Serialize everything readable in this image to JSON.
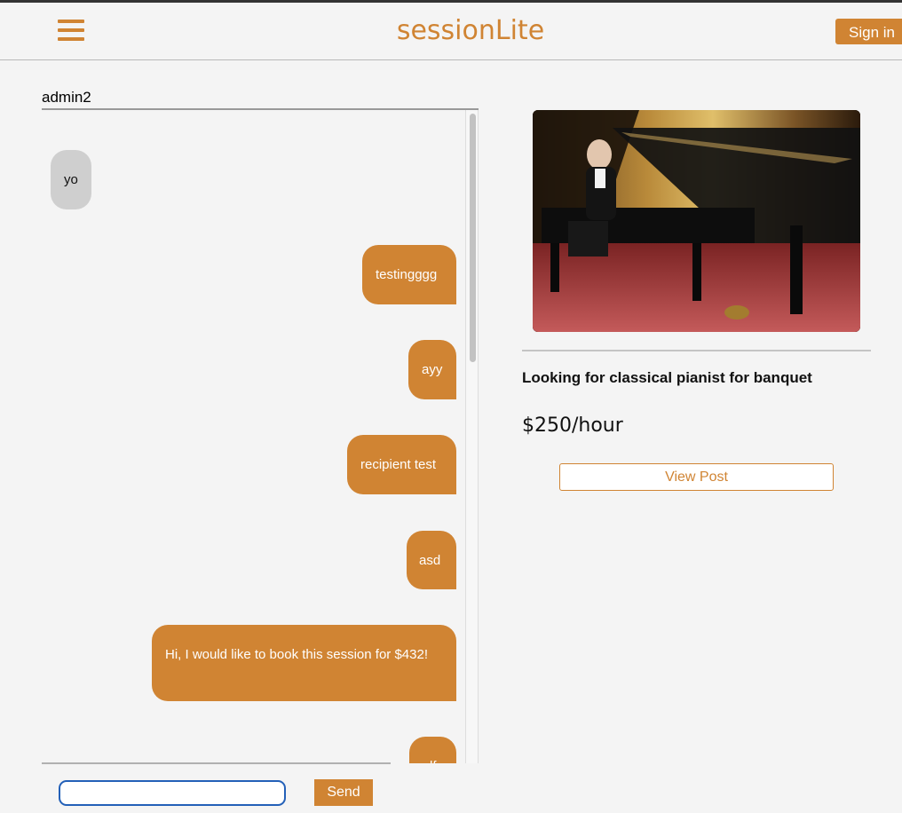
{
  "header": {
    "brand": "sessionLite",
    "signin_label": "Sign in",
    "menu_icon": "hamburger-menu-icon"
  },
  "chat": {
    "recipient": "admin2",
    "messages": [
      {
        "text": "yo",
        "direction": "in"
      },
      {
        "text": "testingggg",
        "direction": "out"
      },
      {
        "text": "ayy",
        "direction": "out"
      },
      {
        "text": "recipient test",
        "direction": "out"
      },
      {
        "text": "asd",
        "direction": "out"
      },
      {
        "text": "Hi, I would like to book this session for $432!",
        "direction": "out"
      },
      {
        "text": "df",
        "direction": "out"
      }
    ],
    "input_value": "",
    "send_label": "Send"
  },
  "post": {
    "image": "pianist-photo",
    "title": "Looking for classical pianist for banquet",
    "price": "$250/hour",
    "view_label": "View Post"
  },
  "colors": {
    "accent": "#d08433",
    "incoming_bubble": "#cfcfcf",
    "input_border": "#2360b8"
  }
}
